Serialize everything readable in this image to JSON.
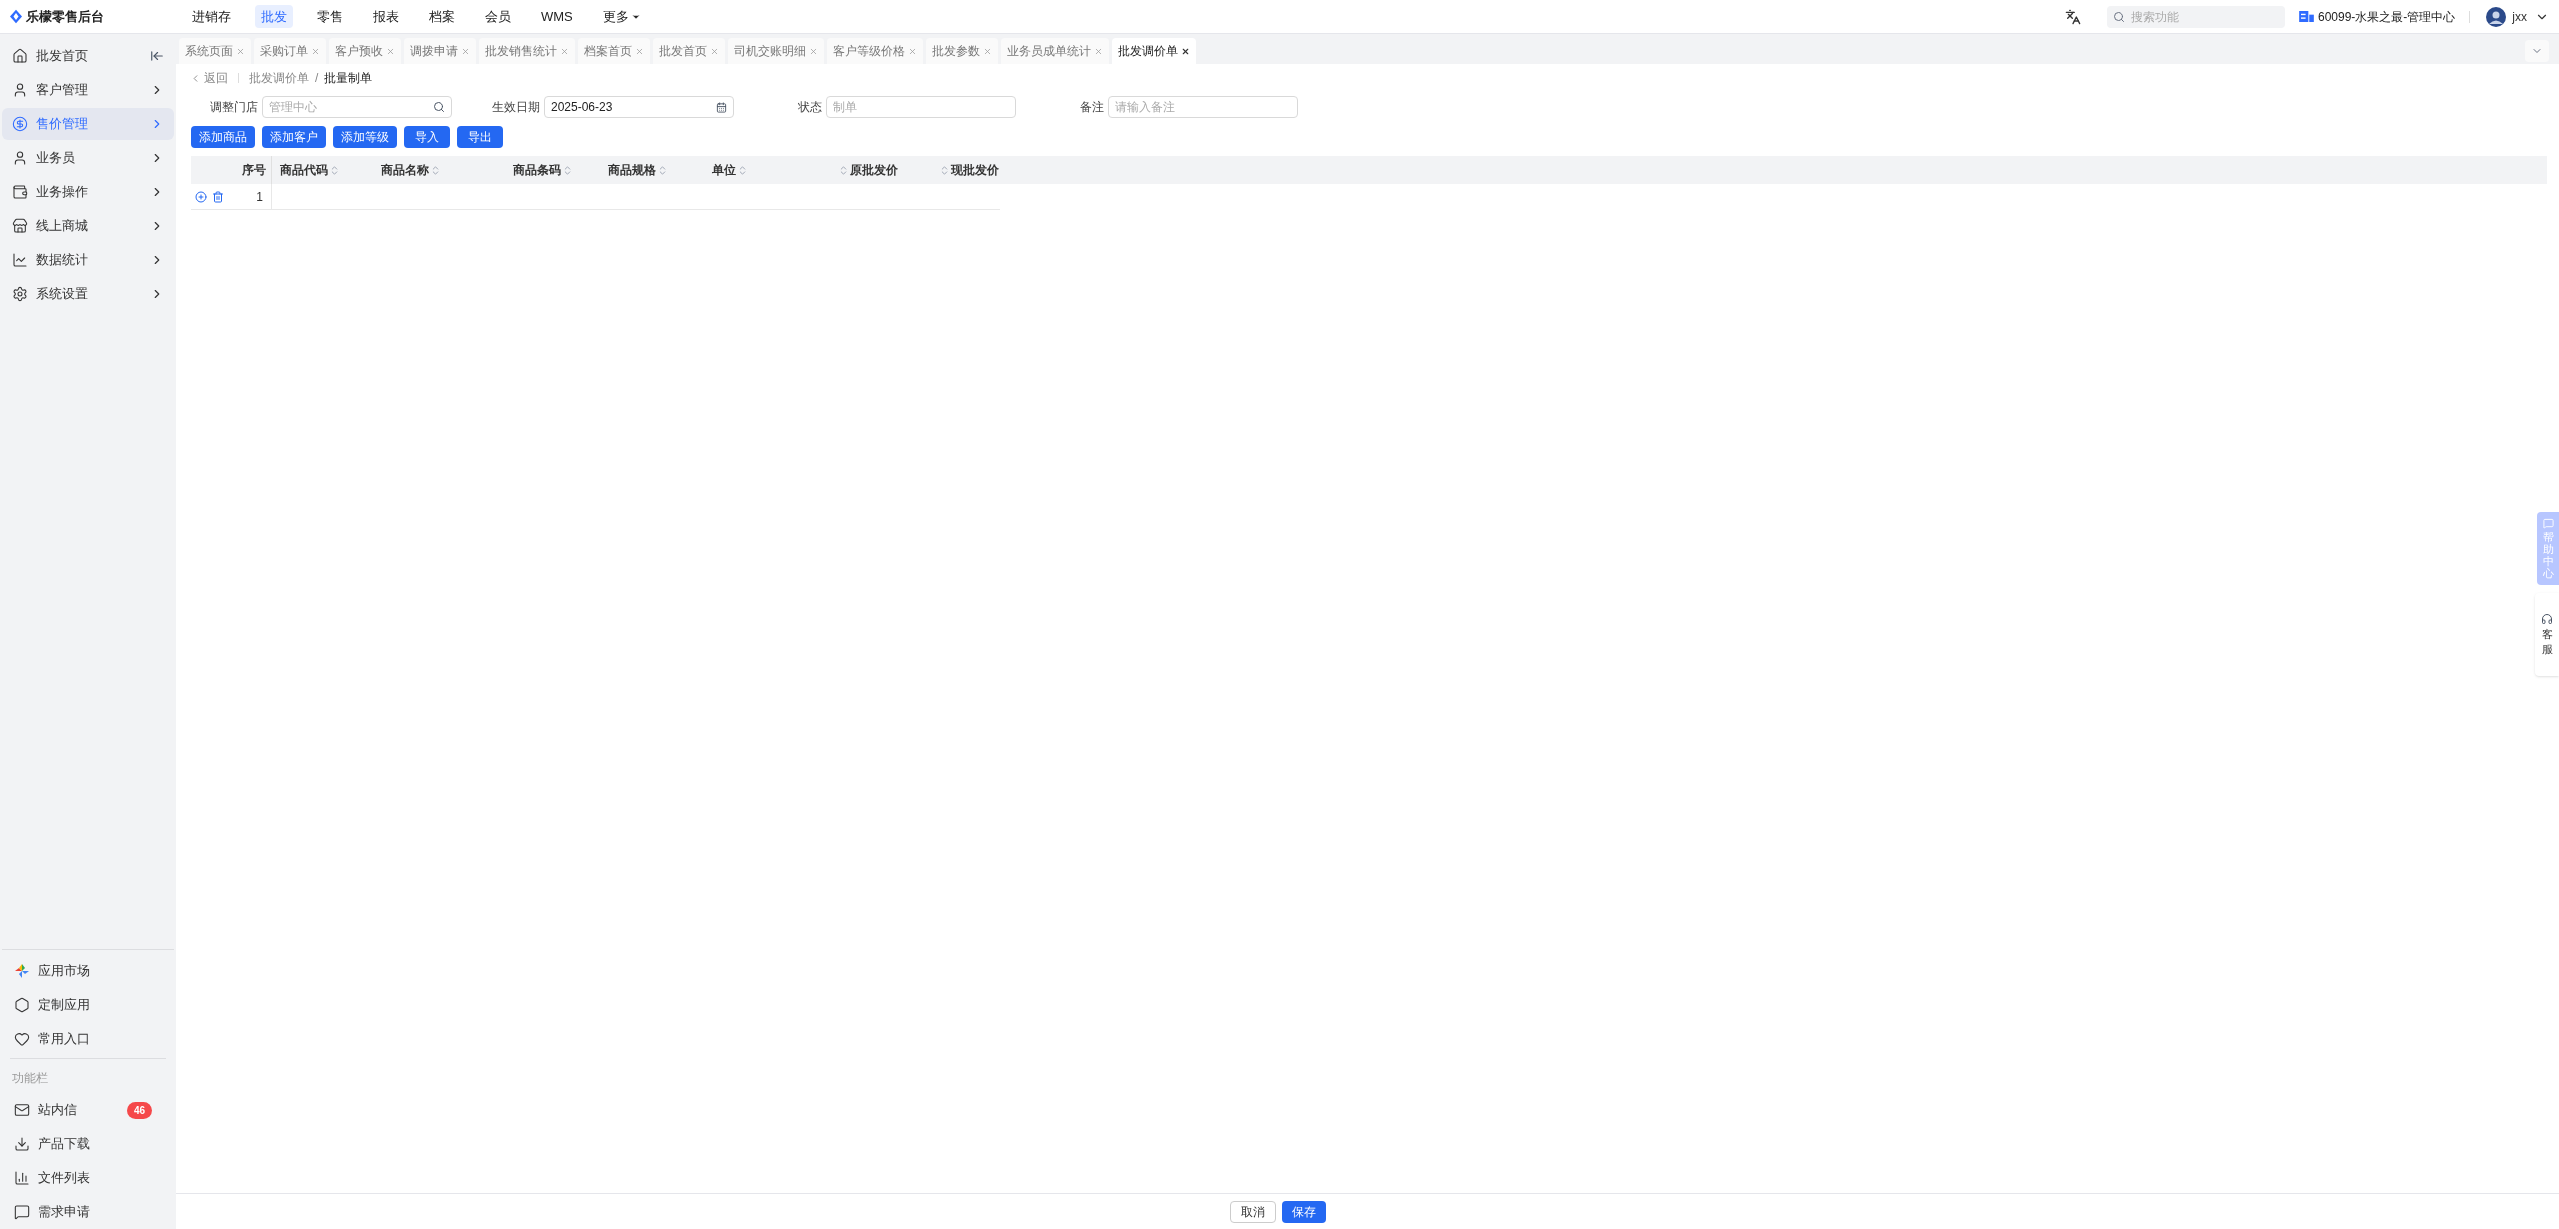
{
  "app_name": "乐檬零售后台",
  "top_nav": [
    {
      "label": "进销存",
      "selected": false
    },
    {
      "label": "批发",
      "selected": true
    },
    {
      "label": "零售",
      "selected": false
    },
    {
      "label": "报表",
      "selected": false
    },
    {
      "label": "档案",
      "selected": false
    },
    {
      "label": "会员",
      "selected": false
    },
    {
      "label": "WMS",
      "selected": false
    },
    {
      "label": "更多",
      "selected": false,
      "dropdown": true
    }
  ],
  "search": {
    "placeholder": "搜索功能"
  },
  "store": "60099-水果之最-管理中心",
  "user": {
    "name": "jxx"
  },
  "sidebar": {
    "items": [
      {
        "label": "批发首页",
        "selected": false,
        "expandable": false
      },
      {
        "label": "客户管理",
        "selected": false,
        "expandable": true
      },
      {
        "label": "售价管理",
        "selected": true,
        "expandable": true
      },
      {
        "label": "业务员",
        "selected": false,
        "expandable": true
      },
      {
        "label": "业务操作",
        "selected": false,
        "expandable": true
      },
      {
        "label": "线上商城",
        "selected": false,
        "expandable": true
      },
      {
        "label": "数据统计",
        "selected": false,
        "expandable": true
      },
      {
        "label": "系统设置",
        "selected": false,
        "expandable": true
      }
    ],
    "bottom_items": [
      {
        "label": "应用市场"
      },
      {
        "label": "定制应用"
      },
      {
        "label": "常用入口"
      }
    ],
    "section_label": "功能栏",
    "function_items": [
      {
        "label": "站内信",
        "badge": "46"
      },
      {
        "label": "产品下载"
      },
      {
        "label": "文件列表"
      },
      {
        "label": "需求申请"
      }
    ]
  },
  "tabs": [
    {
      "label": "系统页面",
      "selected": false
    },
    {
      "label": "采购订单",
      "selected": false
    },
    {
      "label": "客户预收",
      "selected": false
    },
    {
      "label": "调拨申请",
      "selected": false
    },
    {
      "label": "批发销售统计",
      "selected": false
    },
    {
      "label": "档案首页",
      "selected": false
    },
    {
      "label": "批发首页",
      "selected": false
    },
    {
      "label": "司机交账明细",
      "selected": false
    },
    {
      "label": "客户等级价格",
      "selected": false
    },
    {
      "label": "批发参数",
      "selected": false
    },
    {
      "label": "业务员成单统计",
      "selected": false
    },
    {
      "label": "批发调价单",
      "selected": true
    }
  ],
  "breadcrumb": {
    "back": "返回",
    "parent": "批发调价单",
    "separator": "/",
    "current": "批量制单"
  },
  "form": [
    {
      "kind": "search",
      "label": "调整门店",
      "placeholder": "管理中心"
    },
    {
      "kind": "date",
      "label": "生效日期",
      "value": "2025-06-23"
    },
    {
      "kind": "text",
      "label": "状态",
      "placeholder": "制单"
    },
    {
      "kind": "text",
      "label": "备注",
      "placeholder": "请输入备注"
    }
  ],
  "actions": [
    "添加商品",
    "添加客户",
    "添加等级",
    "导入",
    "导出"
  ],
  "table": {
    "columns": [
      {
        "label": "序号",
        "sortable": false
      },
      {
        "label": "商品代码",
        "sortable": true
      },
      {
        "label": "商品名称",
        "sortable": true
      },
      {
        "label": "商品条码",
        "sortable": true
      },
      {
        "label": "商品规格",
        "sortable": true
      },
      {
        "label": "单位",
        "sortable": true
      },
      {
        "label": "原批发价",
        "sortable": true
      },
      {
        "label": "现批发价",
        "sortable": true
      }
    ],
    "rows": [
      {
        "index": "1"
      }
    ]
  },
  "footer_buttons": [
    {
      "label": "取消",
      "kind": "default"
    },
    {
      "label": "保存",
      "kind": "primary"
    }
  ],
  "side_widgets": {
    "help": "帮助中心",
    "service": "客服"
  }
}
